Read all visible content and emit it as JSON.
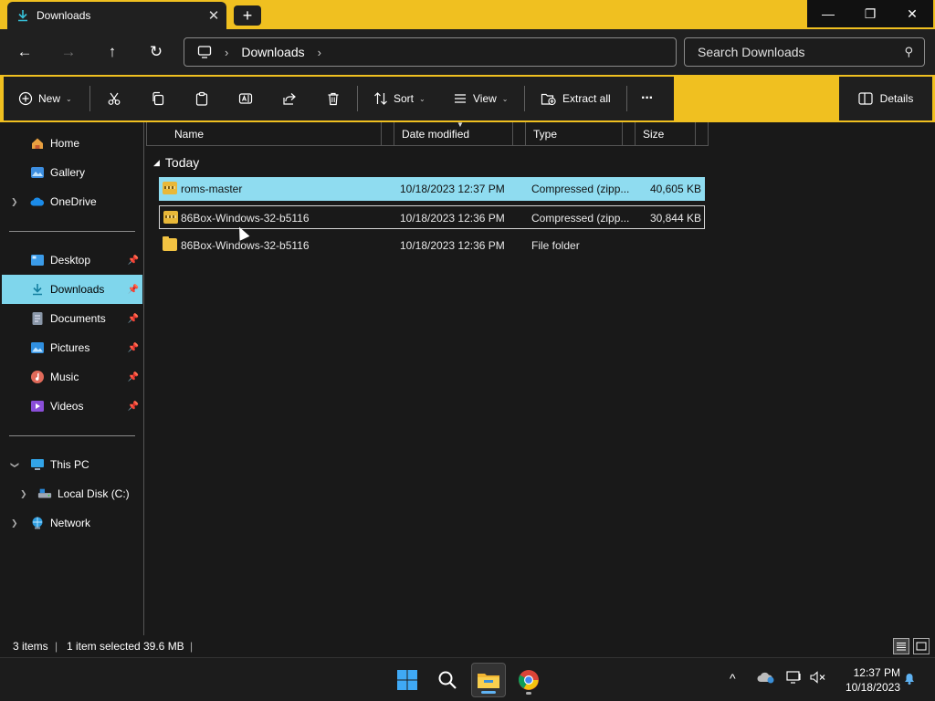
{
  "window": {
    "tab_title": "Downloads",
    "tab_close": "✕",
    "new_tab": "+",
    "minimize": "—",
    "restore": "❐",
    "close": "✕"
  },
  "nav": {
    "back": "←",
    "forward": "→",
    "up": "↑",
    "refresh": "↻"
  },
  "address": {
    "crumb": "Downloads",
    "sep": "›"
  },
  "search": {
    "placeholder": "Search Downloads",
    "icon": "⚲"
  },
  "toolbar": {
    "new_label": "New",
    "sort_label": "Sort",
    "view_label": "View",
    "extract_label": "Extract all",
    "more_label": "···",
    "details_label": "Details",
    "chevron": "⌄"
  },
  "sidebar": {
    "quick": [
      {
        "label": "Home",
        "icon": "home-icon"
      },
      {
        "label": "Gallery",
        "icon": "gallery-icon"
      },
      {
        "label": "OneDrive",
        "icon": "cloud-icon"
      }
    ],
    "pinned": [
      {
        "label": "Desktop"
      },
      {
        "label": "Downloads"
      },
      {
        "label": "Documents"
      },
      {
        "label": "Pictures"
      },
      {
        "label": "Music"
      },
      {
        "label": "Videos"
      }
    ],
    "devices": [
      {
        "label": "This PC"
      },
      {
        "label": "Local Disk (C:)"
      },
      {
        "label": "Network"
      }
    ],
    "selected": "Downloads"
  },
  "columns": {
    "name": "Name",
    "date": "Date modified",
    "type": "Type",
    "size": "Size"
  },
  "group": {
    "label": "Today"
  },
  "files": [
    {
      "name": "roms-master",
      "date": "10/18/2023 12:37 PM",
      "type": "Compressed (zipp...",
      "size": "40,605 KB",
      "kind": "zip",
      "selected": true
    },
    {
      "name": "86Box-Windows-32-b5116",
      "date": "10/18/2023 12:36 PM",
      "type": "Compressed (zipp...",
      "size": "30,844 KB",
      "kind": "zip",
      "selected": false
    },
    {
      "name": "86Box-Windows-32-b5116",
      "date": "10/18/2023 12:36 PM",
      "type": "File folder",
      "size": "",
      "kind": "folder",
      "selected": false
    }
  ],
  "status": {
    "count": "3 items",
    "sep": "|",
    "selection": "1 item selected",
    "selection_size": "39.6 MB"
  },
  "taskbar": {
    "clock_time": "12:37 PM",
    "clock_date": "10/18/2023",
    "tray_chevron": "^"
  },
  "colors": {
    "accent": "#f0c020",
    "selection": "#8fdcf0",
    "background": "#191919"
  }
}
